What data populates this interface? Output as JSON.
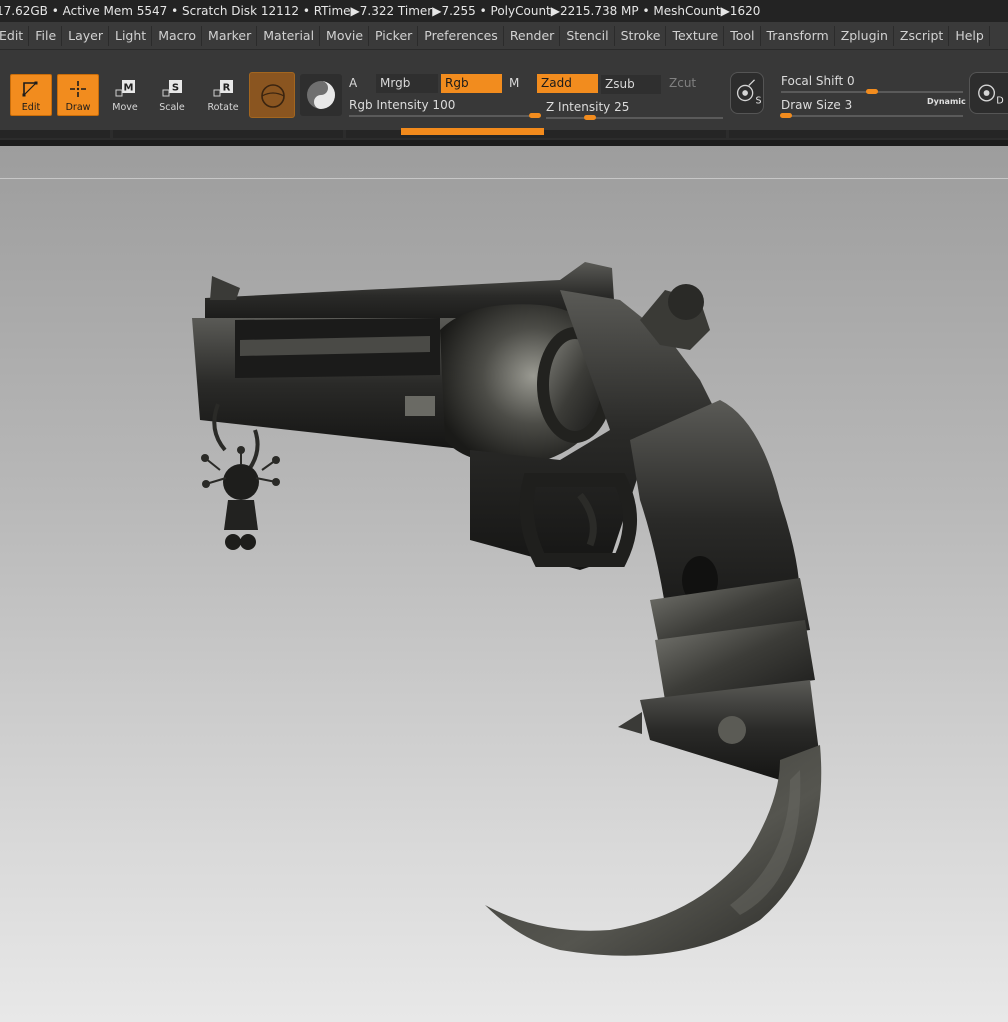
{
  "statusbar": {
    "text": "17.62GB • Active Mem 5547 • Scratch Disk 12112 •  RTime▶7.322 Timer▶7.255 • PolyCount▶2215.738 MP  • MeshCount▶1620"
  },
  "menu": {
    "items": [
      "Edit",
      "File",
      "Layer",
      "Light",
      "Macro",
      "Marker",
      "Material",
      "Movie",
      "Picker",
      "Preferences",
      "Render",
      "Stencil",
      "Stroke",
      "Texture",
      "Tool",
      "Transform",
      "Zplugin",
      "Zscript",
      "Help"
    ]
  },
  "tools": {
    "edit": "Edit",
    "draw": "Draw",
    "move": "Move",
    "scale": "Scale",
    "rotate": "Rotate",
    "move_key": "M",
    "scale_key": "S",
    "rotate_key": "R"
  },
  "options": {
    "a": "A",
    "mrgb": "Mrgb",
    "rgb": "Rgb",
    "m": "M",
    "zadd": "Zadd",
    "zsub": "Zsub",
    "zcut": "Zcut",
    "rgb_intensity_label": "Rgb Intensity 100",
    "rgb_intensity": 100,
    "z_intensity_label": "Z Intensity 25",
    "z_intensity": 25
  },
  "draw_settings": {
    "focal_shift_label": "Focal Shift 0",
    "focal_shift": 0,
    "draw_size_label": "Draw Size 3",
    "draw_size": 3,
    "dynamic": "Dynamic",
    "s_icon_letter": "S",
    "d_icon_letter": "D"
  },
  "colors": {
    "accent": "#f28c1e",
    "toolbar": "#383838",
    "menubar": "#3a3a3a"
  }
}
